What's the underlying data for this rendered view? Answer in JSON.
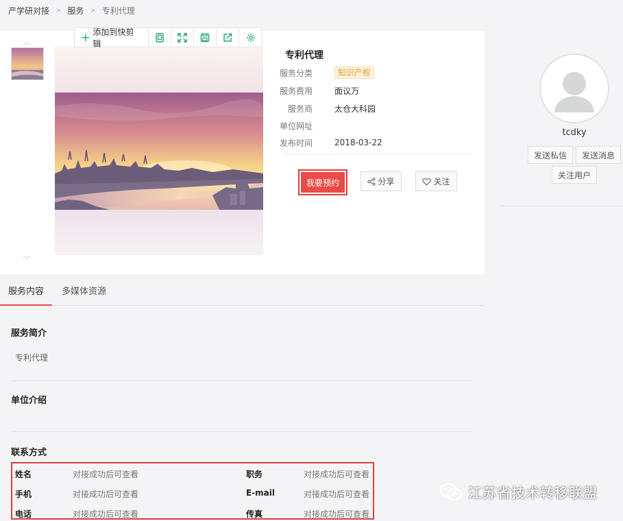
{
  "breadcrumb": {
    "items": [
      "产学研对接",
      "服务",
      "专利代理"
    ],
    "separator": ">"
  },
  "toolbar": {
    "add_label": "添加到快剪辑",
    "icons": [
      "bookmark-icon",
      "expand-icon",
      "save-icon",
      "share-out-icon",
      "gear-icon"
    ]
  },
  "service": {
    "title": "专利代理",
    "category_label": "服务分类",
    "category_value": "知识产权",
    "fee_label": "服务费用",
    "fee_value": "面议万",
    "provider_label": "服务商",
    "provider_value": "太仓大科园",
    "url_label": "单位网址",
    "url_value": "",
    "date_label": "发布时间",
    "date_value": "2018-03-22"
  },
  "actions": {
    "book": "我要预约",
    "share": "分享",
    "follow": "关注"
  },
  "user": {
    "name": "tcdky",
    "private_message": "发送私信",
    "send_message": "发送消息",
    "follow_user": "关注用户"
  },
  "tabs": [
    {
      "label": "服务内容",
      "active": true
    },
    {
      "label": "多媒体资源",
      "active": false
    }
  ],
  "sections": {
    "intro_title": "服务简介",
    "intro_text": "专利代理",
    "org_title": "单位介绍",
    "contact_title": "联系方式"
  },
  "contact": {
    "name_label": "姓名",
    "name_value": "对接成功后可查看",
    "position_label": "职务",
    "position_value": "对接成功后可查看",
    "mobile_label": "手机",
    "mobile_value": "对接成功后可查看",
    "email_label": "E-mail",
    "email_value": "对接成功后可查看",
    "phone_label": "电话",
    "phone_value": "对接成功后可查看",
    "fax_label": "传真",
    "fax_value": "对接成功后可查看"
  },
  "watermark": {
    "text": "江苏省技术转移联盟",
    "icon": "wechat-icon"
  },
  "colors": {
    "accent_red": "#e84b48",
    "highlight_border": "#d84040",
    "toolbar_green": "#1fa17b",
    "tag_orange": "#e79c2a"
  }
}
